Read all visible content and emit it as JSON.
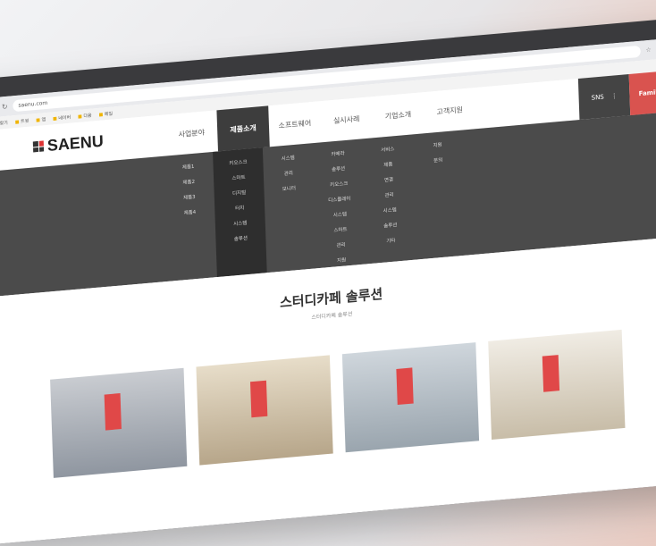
{
  "browser": {
    "url": "saenu.com",
    "bookmarks": [
      "즐겨찾기",
      "트윗",
      "앱",
      "네이버",
      "다음",
      "메일"
    ],
    "sns_label": "SNS",
    "family_label": "Family"
  },
  "site": {
    "logo_text": "SAENU",
    "nav": [
      "사업분야",
      "제품소개",
      "소프트웨어",
      "실시사례",
      "기업소개",
      "고객지원"
    ],
    "active_nav": "제품소개"
  },
  "mega_menu": {
    "columns": [
      [
        "제품1",
        "제품2",
        "제품3",
        "제품4"
      ],
      [
        "키오스크",
        "스마트",
        "디지털",
        "터치",
        "시스템",
        "솔루션"
      ],
      [
        "시스템",
        "관리",
        "모니터"
      ],
      [
        "카메라",
        "솔루션",
        "키오스크",
        "디스플레이",
        "시스템",
        "스마트",
        "관리",
        "지원",
        "기타"
      ],
      [
        "서비스",
        "제품",
        "연결",
        "관리",
        "시스템",
        "솔루션",
        "기타"
      ],
      [
        "지원",
        "문의"
      ]
    ]
  },
  "hero": {
    "title": "스터디카페 솔루션",
    "subtitle": "스터디카페 솔루션"
  }
}
